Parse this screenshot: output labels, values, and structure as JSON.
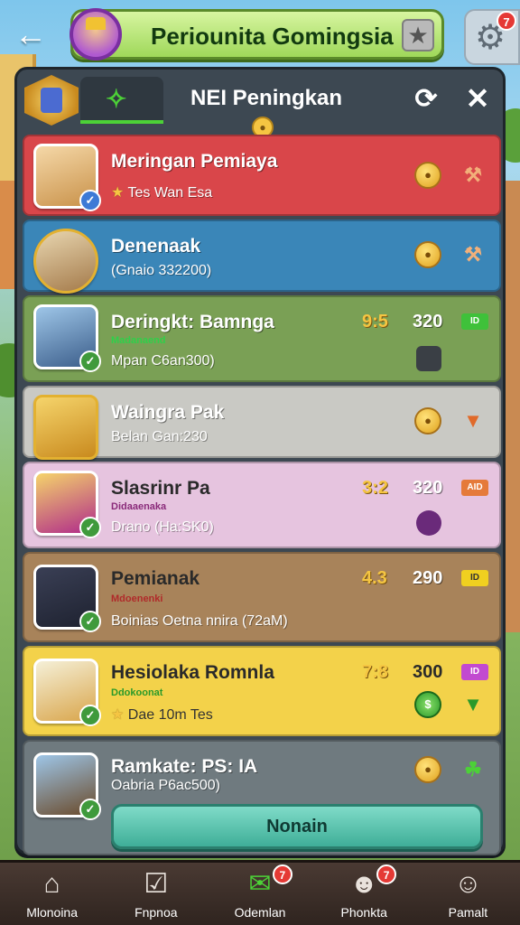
{
  "topbar": {
    "back_icon": "arrow-left-icon",
    "title": "Periounita Gomingsia",
    "star_icon": "star-icon",
    "gear_badge": "7"
  },
  "panel": {
    "title": "NEI Peningkan",
    "tab_icon": "tag-icon",
    "close_icon": "close-icon",
    "refresh_icon": "refresh-icon"
  },
  "rows": [
    {
      "name": "Meringan Pemiaya",
      "sub": "",
      "detail": "Tes   Wan Esa",
      "rating": "",
      "score": "",
      "tag": "",
      "color": "#d9464a"
    },
    {
      "name": "Denenaak",
      "sub": "",
      "detail": "(Gnaio 332200)",
      "rating": "",
      "score": "",
      "tag": "",
      "color": "#3a86b8"
    },
    {
      "name": "Deringkt: Bamnga",
      "sub": "Madanaend",
      "detail": "Mpan C6an300)",
      "rating": "9:5",
      "score": "320",
      "tag": "ID",
      "color": "#7aa055"
    },
    {
      "name": "Waingra Pak",
      "sub": "",
      "detail": "Belan Gan:230",
      "rating": "",
      "score": "",
      "tag": "",
      "color": "#c9c9c4"
    },
    {
      "name": "Slasrinr Pa",
      "sub": "Didaaenaka",
      "detail": "Drano (Ha:SK0)",
      "rating": "3:2",
      "score": "320",
      "tag": "AID",
      "color": "#e6c4df"
    },
    {
      "name": "Pemianak",
      "sub": "Mdoenenki",
      "detail": "Boinias   Oetna nnira (72aM)",
      "rating": "4.3",
      "score": "290",
      "tag": "ID",
      "color": "#a8835a"
    },
    {
      "name": "Hesiolaka Romnla",
      "sub": "Ddokoonat",
      "detail": "Dae   10m Tes",
      "rating": "7:8",
      "score": "300",
      "tag": "ID",
      "color": "#f3d24a"
    },
    {
      "name": "Ramkate: PS: IA",
      "sub": "",
      "detail": "Oabria P6ac500)",
      "rating": "",
      "score": "",
      "tag": "",
      "color": "#6f7a7f"
    }
  ],
  "confirm_label": "Nonain",
  "nav": [
    {
      "label": "Mlonoina",
      "icon": "home-icon",
      "badge": ""
    },
    {
      "label": "Fnpnoa",
      "icon": "tasks-icon",
      "badge": ""
    },
    {
      "label": "Odemlan",
      "icon": "chat-icon",
      "badge": "7"
    },
    {
      "label": "Phonkta",
      "icon": "friends-icon",
      "badge": "7"
    },
    {
      "label": "Pamalt",
      "icon": "profile-icon",
      "badge": ""
    }
  ]
}
